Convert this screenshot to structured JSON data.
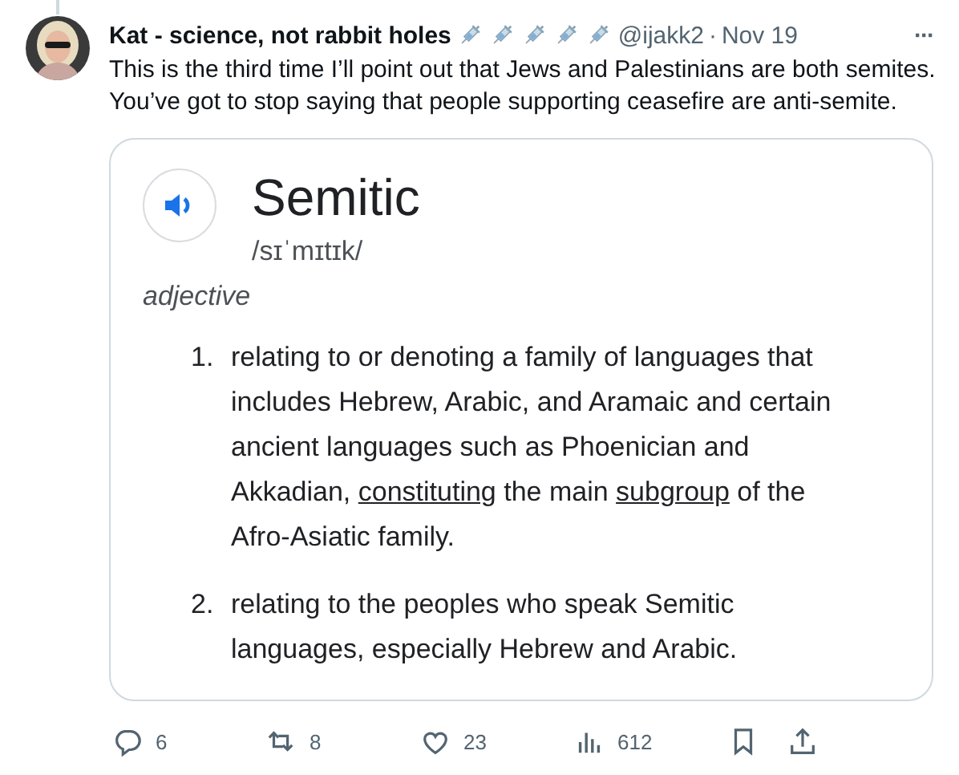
{
  "tweet": {
    "author": "Kat - science, not rabbit holes",
    "badges": [
      {
        "kind": "syringe"
      },
      {
        "kind": "syringe"
      },
      {
        "kind": "syringe"
      },
      {
        "kind": "syringe"
      },
      {
        "kind": "syringe"
      }
    ],
    "handle": "@ijakk2",
    "separator": "·",
    "date": "Nov 19",
    "more": "···",
    "text": [
      "This is the third time I’ll point out that Jews and Palestinians are both semites.",
      "You’ve got to stop saying that people supporting ceasefire are anti-semite."
    ],
    "image": {
      "word": "Semitic",
      "pronunciation": "/sɪˈmɪtɪk/",
      "part_of_speech": "adjective",
      "definitions": [
        {
          "number": "1.",
          "parts": [
            {
              "kind": "text",
              "text": "relating to or denoting a family of languages that includes Hebrew, Arabic, and Aramaic and certain ancient languages such as Phoenician and Akkadian, "
            },
            {
              "kind": "link",
              "text": "constituting"
            },
            {
              "kind": "text",
              "text": " the main "
            },
            {
              "kind": "link",
              "text": "subgroup"
            },
            {
              "kind": "text",
              "text": " of the Afro-Asiatic family."
            }
          ]
        },
        {
          "number": "2.",
          "parts": [
            {
              "kind": "text",
              "text": "relating to the peoples who speak Semitic languages, especially Hebrew and Arabic."
            }
          ]
        }
      ]
    },
    "actions": [
      {
        "kind": "reply",
        "count": "6"
      },
      {
        "kind": "retweet",
        "count": "8"
      },
      {
        "kind": "like",
        "count": "23"
      },
      {
        "kind": "views",
        "count": "612"
      },
      {
        "kind": "bookmark"
      },
      {
        "kind": "share"
      }
    ]
  }
}
